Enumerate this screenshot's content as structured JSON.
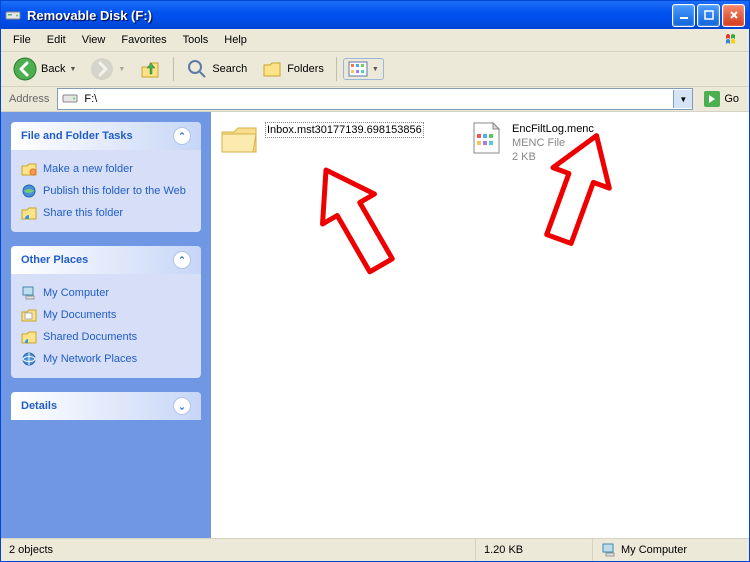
{
  "window": {
    "title": "Removable Disk (F:)"
  },
  "menubar": {
    "items": [
      "File",
      "Edit",
      "View",
      "Favorites",
      "Tools",
      "Help"
    ]
  },
  "toolbar": {
    "back_label": "Back",
    "search_label": "Search",
    "folders_label": "Folders"
  },
  "addressbar": {
    "label": "Address",
    "value": "F:\\",
    "go_label": "Go"
  },
  "sidebar": {
    "panels": [
      {
        "title": "File and Folder Tasks",
        "links": [
          {
            "icon": "folder-new-icon",
            "label": "Make a new folder"
          },
          {
            "icon": "publish-web-icon",
            "label": "Publish this folder to the Web"
          },
          {
            "icon": "share-folder-icon",
            "label": "Share this folder"
          }
        ]
      },
      {
        "title": "Other Places",
        "links": [
          {
            "icon": "my-computer-icon",
            "label": "My Computer"
          },
          {
            "icon": "my-documents-icon",
            "label": "My Documents"
          },
          {
            "icon": "shared-documents-icon",
            "label": "Shared Documents"
          },
          {
            "icon": "network-places-icon",
            "label": "My Network Places"
          }
        ]
      },
      {
        "title": "Details",
        "links": []
      }
    ]
  },
  "content": {
    "items": [
      {
        "type": "folder",
        "name": "Inbox.mst30177139.698153856",
        "selected": true
      },
      {
        "type": "file",
        "name": "EncFiltLog.menc",
        "filetype": "MENC File",
        "size": "2 KB"
      }
    ]
  },
  "statusbar": {
    "object_count": "2 objects",
    "total_size": "1.20 KB",
    "location": "My Computer"
  }
}
